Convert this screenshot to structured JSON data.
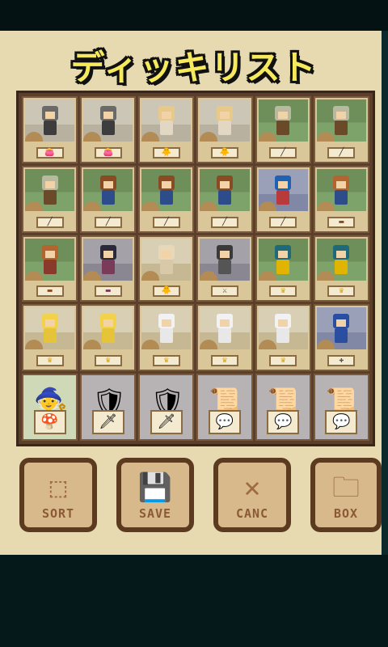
{
  "title": "ディッキリスト",
  "slots": [
    {
      "scene": "s-light",
      "hair": "#6a6a6a",
      "body": "#3d3d3d",
      "label": "👛",
      "labelColor": "#b06ab0"
    },
    {
      "scene": "s-light",
      "hair": "#6a6a6a",
      "body": "#3d3d3d",
      "label": "👛",
      "labelColor": "#b06ab0"
    },
    {
      "scene": "s-light",
      "hair": "#e9c98a",
      "body": "#e2d7c3",
      "label": "🐥",
      "labelColor": "#e0b400"
    },
    {
      "scene": "s-light",
      "hair": "#e9c98a",
      "body": "#e2d7c3",
      "label": "🐥",
      "labelColor": "#e0b400"
    },
    {
      "scene": "s-grass",
      "hair": "#b9b9a0",
      "body": "#6b4a2a",
      "label": "╱",
      "labelColor": "#333"
    },
    {
      "scene": "s-grass",
      "hair": "#b9b9a0",
      "body": "#6b4a2a",
      "label": "╱",
      "labelColor": "#333"
    },
    {
      "scene": "s-grass",
      "hair": "#b9b9a0",
      "body": "#6b4a2a",
      "label": "╱",
      "labelColor": "#333"
    },
    {
      "scene": "s-grass",
      "hair": "#8a4a24",
      "body": "#2d4c8a",
      "label": "╱",
      "labelColor": "#333"
    },
    {
      "scene": "s-grass",
      "hair": "#8a4a24",
      "body": "#2d4c8a",
      "label": "╱",
      "labelColor": "#333"
    },
    {
      "scene": "s-grass",
      "hair": "#8a4a24",
      "body": "#2d4c8a",
      "label": "╱",
      "labelColor": "#333"
    },
    {
      "scene": "s-blue",
      "hair": "#1e63b3",
      "body": "#b83a3a",
      "label": "╱",
      "labelColor": "#333"
    },
    {
      "scene": "s-grass",
      "hair": "#b3642f",
      "body": "#2d4c8a",
      "label": "▬",
      "labelColor": "#8a4a24"
    },
    {
      "scene": "s-grass",
      "hair": "#b3642f",
      "body": "#8a3a2a",
      "label": "▬",
      "labelColor": "#8a4a24"
    },
    {
      "scene": "s-dark",
      "hair": "#2a2a3a",
      "body": "#7a3a5a",
      "label": "▬",
      "labelColor": "#7a3a5a"
    },
    {
      "scene": "s-sand",
      "hair": "#e6d8b8",
      "body": "#d9c9a8",
      "label": "🐥",
      "labelColor": "#e0b400"
    },
    {
      "scene": "s-dark",
      "hair": "#3a3a3a",
      "body": "#555",
      "label": "⚔",
      "labelColor": "#444"
    },
    {
      "scene": "s-grass",
      "hair": "#1e6a7a",
      "body": "#e0b400",
      "label": "♛",
      "labelColor": "#d9a400"
    },
    {
      "scene": "s-grass",
      "hair": "#1e6a7a",
      "body": "#e0b400",
      "label": "♛",
      "labelColor": "#d9a400"
    },
    {
      "scene": "s-sand",
      "hair": "#f2d24a",
      "body": "#e6c43a",
      "label": "♛",
      "labelColor": "#d9a400"
    },
    {
      "scene": "s-sand",
      "hair": "#f2d24a",
      "body": "#e6c43a",
      "label": "♛",
      "labelColor": "#d9a400"
    },
    {
      "scene": "s-sand",
      "hair": "#f2f2f2",
      "body": "#e8e8e8",
      "label": "♛",
      "labelColor": "#d9a400"
    },
    {
      "scene": "s-sand",
      "hair": "#f2f2f2",
      "body": "#e8e8e8",
      "label": "♛",
      "labelColor": "#d9a400"
    },
    {
      "scene": "s-sand",
      "hair": "#f2f2f2",
      "body": "#e8e8e8",
      "label": "♛",
      "labelColor": "#d9a400"
    },
    {
      "scene": "s-blue",
      "hair": "#2a4fa0",
      "body": "#2a4fa0",
      "label": "✚",
      "labelColor": "#555"
    }
  ],
  "items": [
    {
      "icon": "🧙",
      "label": "🍄"
    },
    {
      "icon": "🛡",
      "label": "🗡"
    },
    {
      "icon": "🛡",
      "label": "🗡"
    },
    {
      "icon": "📜",
      "label": "💬"
    },
    {
      "icon": "📜",
      "label": "💬"
    },
    {
      "icon": "📜",
      "label": "💬"
    }
  ],
  "buttons": [
    {
      "name": "sort",
      "label": "SORT",
      "icon": "⬚"
    },
    {
      "name": "save",
      "label": "SAVE",
      "icon": "💾"
    },
    {
      "name": "cancel",
      "label": "CANC",
      "icon": "✕"
    },
    {
      "name": "box",
      "label": "BOX",
      "icon": "🗀"
    }
  ]
}
